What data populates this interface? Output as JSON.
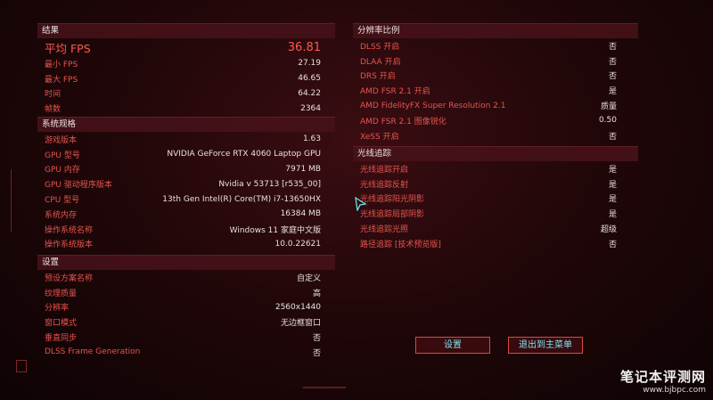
{
  "results": {
    "heading": "结果",
    "avg_fps_label": "平均 FPS",
    "avg_fps_value": "36.81",
    "rows": [
      {
        "label": "最小 FPS",
        "value": "27.19"
      },
      {
        "label": "最大 FPS",
        "value": "46.65"
      },
      {
        "label": "时间",
        "value": "64.22"
      },
      {
        "label": "帧数",
        "value": "2364"
      }
    ]
  },
  "specs": {
    "heading": "系统规格",
    "rows": [
      {
        "label": "游戏版本",
        "value": "1.63"
      },
      {
        "label": "GPU 型号",
        "value": "NVIDIA GeForce RTX 4060 Laptop GPU"
      },
      {
        "label": "GPU 内存",
        "value": "7971 MB"
      },
      {
        "label": "GPU 驱动程序版本",
        "value": "Nvidia v 53713 [r535_00]"
      },
      {
        "label": "CPU 型号",
        "value": "13th Gen Intel(R) Core(TM) i7-13650HX"
      },
      {
        "label": "系统内存",
        "value": "16384 MB"
      },
      {
        "label": "操作系统名称",
        "value": "Windows 11 家庭中文版"
      },
      {
        "label": "操作系统版本",
        "value": "10.0.22621"
      }
    ]
  },
  "settings": {
    "heading": "设置",
    "rows": [
      {
        "label": "预设方案名称",
        "value": "自定义"
      },
      {
        "label": "纹理质量",
        "value": "高"
      },
      {
        "label": "分辨率",
        "value": "2560x1440"
      },
      {
        "label": "窗口模式",
        "value": "无边框窗口"
      },
      {
        "label": "垂直同步",
        "value": "否"
      },
      {
        "label": "DLSS Frame Generation",
        "value": "否"
      }
    ]
  },
  "resolution_scaling": {
    "heading": "分辨率比例",
    "rows": [
      {
        "label": "DLSS 开启",
        "value": "否"
      },
      {
        "label": "DLAA 开启",
        "value": "否"
      },
      {
        "label": "DRS 开启",
        "value": "否"
      },
      {
        "label": "AMD FSR 2.1 开启",
        "value": "是"
      },
      {
        "label": "AMD FidelityFX Super Resolution 2.1",
        "value": "质量"
      },
      {
        "label": "AMD FSR 2.1 图像锐化",
        "value": "0.50"
      },
      {
        "label": "XeSS 开启",
        "value": "否"
      }
    ]
  },
  "ray_tracing": {
    "heading": "光线追踪",
    "rows": [
      {
        "label": "光线追踪开启",
        "value": "是"
      },
      {
        "label": "光线追踪反射",
        "value": "是"
      },
      {
        "label": "光线追踪阳光阴影",
        "value": "是"
      },
      {
        "label": "光线追踪局部阴影",
        "value": "是"
      },
      {
        "label": "光线追踪光照",
        "value": "超级"
      },
      {
        "label": "路径追踪 [技术预览版]",
        "value": "否"
      }
    ]
  },
  "buttons": {
    "settings": "设置",
    "exit_main_menu": "退出到主菜单"
  },
  "watermark": {
    "title": "笔记本评测网",
    "url": "www.bjbpc.com"
  },
  "colors": {
    "label_red": "#e5554e",
    "accent_cyan": "#7ee6ef",
    "header_bg": "#461218"
  }
}
